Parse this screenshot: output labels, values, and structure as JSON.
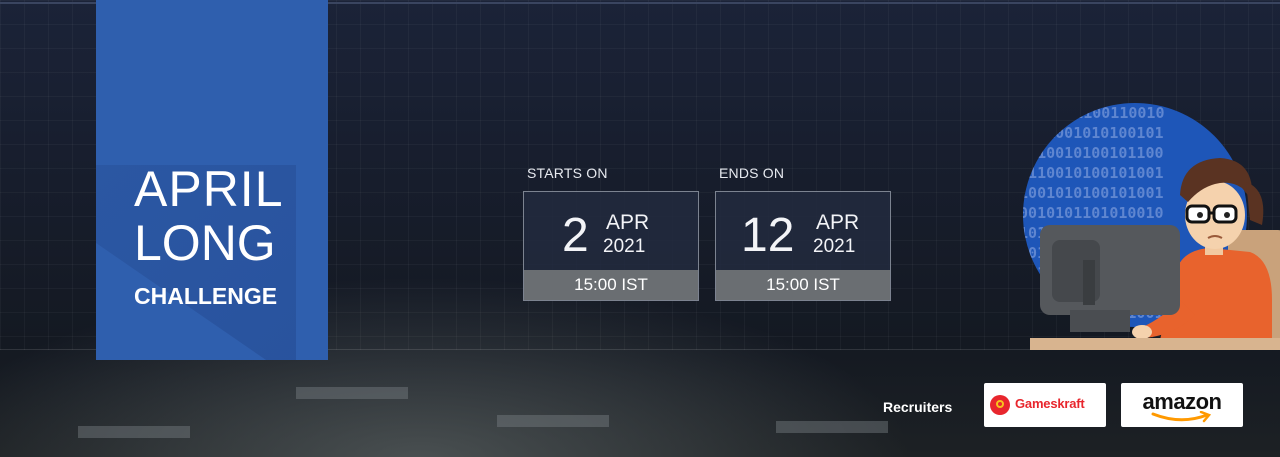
{
  "event": {
    "title_line1": "APRIL",
    "title_line2": "LONG",
    "title_line3": "CHALLENGE"
  },
  "schedule": {
    "start": {
      "label": "STARTS ON",
      "day": "2",
      "month": "APR",
      "year": "2021",
      "time": "15:00 IST"
    },
    "end": {
      "label": "ENDS ON",
      "day": "12",
      "month": "APR",
      "year": "2021",
      "time": "15:00 IST"
    }
  },
  "recruiters": {
    "label": "Recruiters",
    "logos": [
      {
        "name": "Gameskraft",
        "icon": "gameskraft-logo"
      },
      {
        "name": "amazon",
        "icon": "amazon-logo"
      }
    ]
  },
  "illustration": {
    "binary_text": "0100101100110 01011001010100 1001001010010 1011001010010 0100101010010 1001010110101 0101001010010 01011001010 101001101001",
    "icon": "coder-at-computer-illustration"
  },
  "colors": {
    "title_block": "#2f5fae",
    "time_bar": "#6a6e72",
    "gameskraft_red": "#e8262d",
    "amazon_orange": "#ff9900",
    "binary_circle": "#1e56b8"
  }
}
